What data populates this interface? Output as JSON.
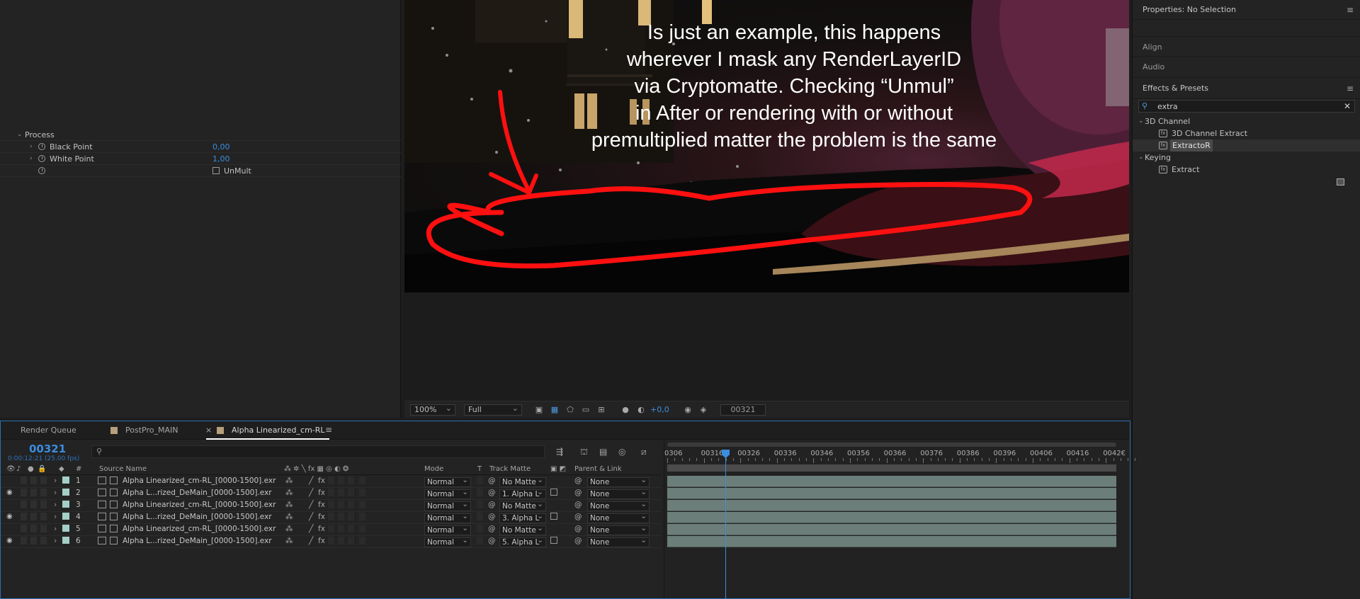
{
  "effect_controls": {
    "group": "Process",
    "props": [
      {
        "label": "Black Point",
        "value": "0,00"
      },
      {
        "label": "White Point",
        "value": "1,00"
      }
    ],
    "checkbox_label": "UnMult"
  },
  "viewer": {
    "annotation_lines": [
      "Is just an example, this happens",
      "wherever I mask any RenderLayerID",
      "via Cryptomatte. Checking “Unmul”",
      "in After or rendering with or without",
      "premultiplied matter the problem is the same"
    ],
    "zoom": "100%",
    "resolution": "Full",
    "exposure": "+0,0",
    "current_frame": "00321"
  },
  "right_panel": {
    "properties_title": "Properties: No Selection",
    "align_title": "Align",
    "audio_title": "Audio",
    "effects_title": "Effects & Presets",
    "search_value": "extra",
    "tree": [
      {
        "label": "3D Channel",
        "kind": "folder"
      },
      {
        "label": "3D Channel Extract",
        "kind": "effect"
      },
      {
        "label": "ExtractoR",
        "kind": "effect",
        "selected": true
      },
      {
        "label": "Keying",
        "kind": "folder"
      },
      {
        "label": "Extract",
        "kind": "effect"
      }
    ]
  },
  "timeline": {
    "tabs": [
      {
        "label": "Render Queue"
      },
      {
        "label": "PostPro_MAIN"
      },
      {
        "label": "Alpha Linearized_cm-RL"
      }
    ],
    "timecode": "00321",
    "timecode_sub": "0:00:12:21 (25.00 fps)",
    "columns": {
      "hash": "#",
      "source": "Source Name",
      "mode": "Mode",
      "t": "T",
      "track_matte": "Track Matte",
      "parent": "Parent & Link"
    },
    "layers": [
      {
        "num": "1",
        "name": "Alpha Linearized_cm-RL_[0000-1500].exr",
        "eye": false,
        "mode": "Normal",
        "matte": "No Matte",
        "matte_icon": false,
        "parent": "None"
      },
      {
        "num": "2",
        "name": "Alpha L...rized_DeMain_[0000-1500].exr",
        "eye": true,
        "mode": "Normal",
        "matte": "1. Alpha L",
        "matte_icon": true,
        "parent": "None"
      },
      {
        "num": "3",
        "name": "Alpha Linearized_cm-RL_[0000-1500].exr",
        "eye": false,
        "mode": "Normal",
        "matte": "No Matte",
        "matte_icon": false,
        "parent": "None"
      },
      {
        "num": "4",
        "name": "Alpha L...rized_DeMain_[0000-1500].exr",
        "eye": true,
        "mode": "Normal",
        "matte": "3. Alpha L",
        "matte_icon": true,
        "parent": "None"
      },
      {
        "num": "5",
        "name": "Alpha Linearized_cm-RL_[0000-1500].exr",
        "eye": false,
        "mode": "Normal",
        "matte": "No Matte",
        "matte_icon": false,
        "parent": "None"
      },
      {
        "num": "6",
        "name": "Alpha L...rized_DeMain_[0000-1500].exr",
        "eye": true,
        "mode": "Normal",
        "matte": "5. Alpha L",
        "matte_icon": true,
        "parent": "None"
      }
    ],
    "ruler_labels": [
      "0306",
      "00316",
      "00326",
      "00336",
      "00346",
      "00356",
      "00366",
      "00376",
      "00386",
      "00396",
      "00406",
      "00416",
      "0042€"
    ]
  }
}
